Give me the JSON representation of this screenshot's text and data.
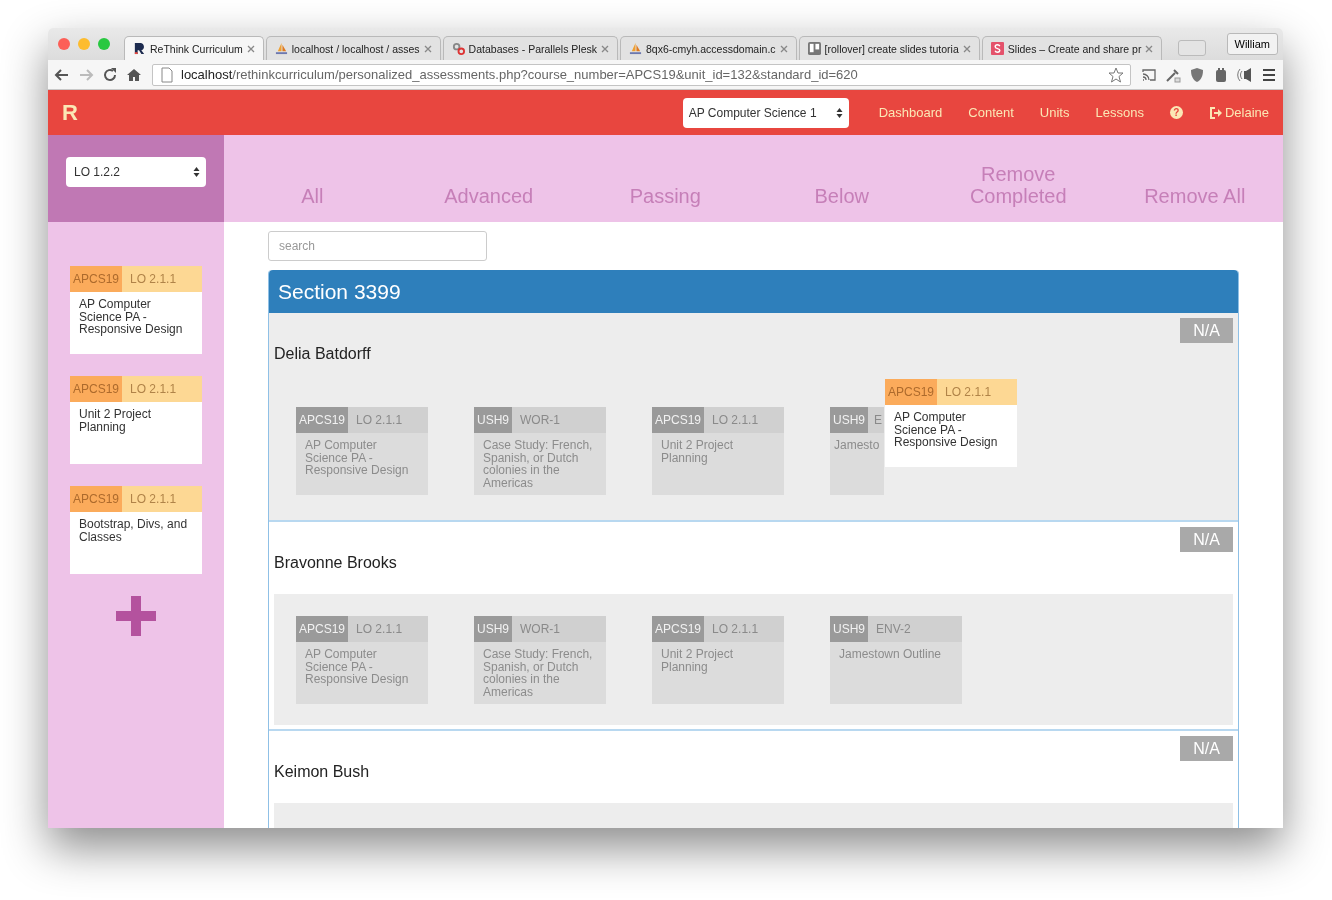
{
  "browser": {
    "tabs": [
      {
        "title": "ReThink Curriculum",
        "kind": "rethink",
        "selected": true
      },
      {
        "title": "localhost / localhost / asses",
        "kind": "pma",
        "selected": false
      },
      {
        "title": "Databases - Parallels Plesk",
        "kind": "plesk",
        "selected": false
      },
      {
        "title": "8qx6-cmyh.accessdomain.c",
        "kind": "pma",
        "selected": false
      },
      {
        "title": "[rollover] create slides tutoria",
        "kind": "trello",
        "selected": false
      },
      {
        "title": "Slides – Create and share pr",
        "kind": "slides",
        "selected": false
      }
    ],
    "profile": "William",
    "url_host": "localhost",
    "url_path": "/rethinkcurriculum/personalized_assessments.php?course_number=APCS19&unit_id=132&standard_id=620"
  },
  "app": {
    "logo": "R",
    "course_select": "AP Computer Science 1",
    "nav": [
      "Dashboard",
      "Content",
      "Units",
      "Lessons"
    ],
    "help": "?",
    "user": "Delaine"
  },
  "sidebar": {
    "standard_select": "LO 1.2.2",
    "cards": [
      {
        "course": "APCS19",
        "code": "LO 2.1.1",
        "title": "AP Computer Science PA - Responsive Design"
      },
      {
        "course": "APCS19",
        "code": "LO 2.1.1",
        "title": "Unit 2 Project Planning"
      },
      {
        "course": "APCS19",
        "code": "LO 2.1.1",
        "title": "Bootstrap, Divs, and Classes"
      }
    ]
  },
  "filters": [
    "All",
    "Advanced",
    "Passing",
    "Below",
    "Remove Completed",
    "Remove All"
  ],
  "search": {
    "placeholder": "search"
  },
  "section": {
    "title": "Section 3399",
    "students": [
      {
        "name": "Delia Batdorff",
        "status": "N/A",
        "highlighted": true,
        "cards": [
          {
            "course": "APCS19",
            "code": "LO 2.1.1",
            "title": "AP Computer Science PA - Responsive Design"
          },
          {
            "course": "USH9",
            "code": "WOR-1",
            "title": "Case Study: French, Spanish, or Dutch colonies in the Americas"
          },
          {
            "course": "APCS19",
            "code": "LO 2.1.1",
            "title": "Unit 2 Project Planning"
          },
          {
            "course": "USH9",
            "code": "E",
            "title": "Jamesto"
          }
        ]
      },
      {
        "name": "Bravonne Brooks",
        "status": "N/A",
        "highlighted": false,
        "cards": [
          {
            "course": "APCS19",
            "code": "LO 2.1.1",
            "title": "AP Computer Science PA - Responsive Design"
          },
          {
            "course": "USH9",
            "code": "WOR-1",
            "title": "Case Study: French, Spanish, or Dutch colonies in the Americas"
          },
          {
            "course": "APCS19",
            "code": "LO 2.1.1",
            "title": "Unit 2 Project Planning"
          },
          {
            "course": "USH9",
            "code": "ENV-2",
            "title": "Jamestown Outline"
          }
        ]
      },
      {
        "name": "Keimon Bush",
        "status": "N/A",
        "highlighted": false
      }
    ],
    "dragged_card": {
      "course": "APCS19",
      "code": "LO 2.1.1",
      "title": "AP Computer Science PA - Responsive Design"
    }
  }
}
